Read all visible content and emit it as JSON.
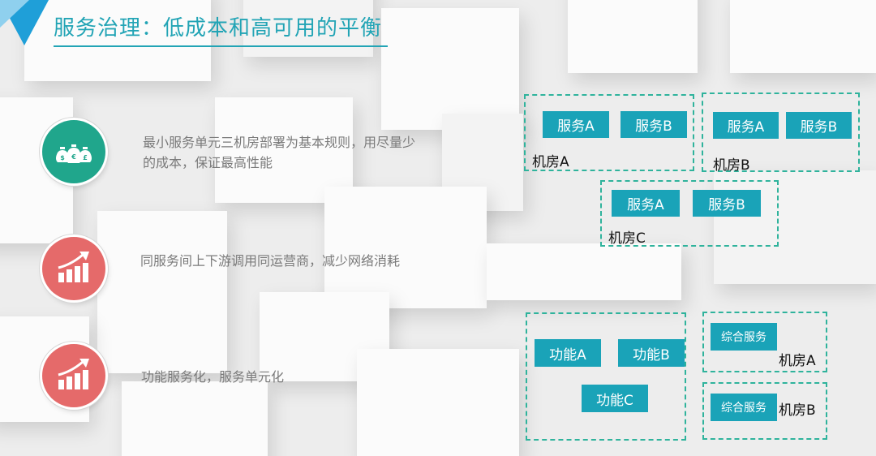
{
  "title": "服务治理：低成本和高可用的平衡",
  "points": [
    {
      "text": "最小服务单元三机房部署为基本规则，用尽量少的成本，保证最高性能",
      "icon": "money-bags-icon",
      "color": "#20a68c"
    },
    {
      "text": "同服务间上下游调用同运营商，减少网络消耗",
      "icon": "growth-chart-icon",
      "color": "#e56a6a"
    },
    {
      "text": "功能服务化，服务单元化",
      "icon": "growth-chart-icon",
      "color": "#e56a6a"
    }
  ],
  "top_diagram": {
    "rooms": [
      {
        "label": "机房A",
        "services": [
          "服务A",
          "服务B"
        ]
      },
      {
        "label": "机房B",
        "services": [
          "服务A",
          "服务B"
        ]
      },
      {
        "label": "机房C",
        "services": [
          "服务A",
          "服务B"
        ]
      }
    ]
  },
  "bottom_diagram": {
    "functions": [
      "功能A",
      "功能B",
      "功能C"
    ],
    "rooms": [
      {
        "label": "机房A",
        "service": "综合服务"
      },
      {
        "label": "机房B",
        "service": "综合服务"
      }
    ]
  },
  "colors": {
    "accent": "#22a4b5",
    "box": "#1aa3b8",
    "dash": "#2fb39c"
  }
}
